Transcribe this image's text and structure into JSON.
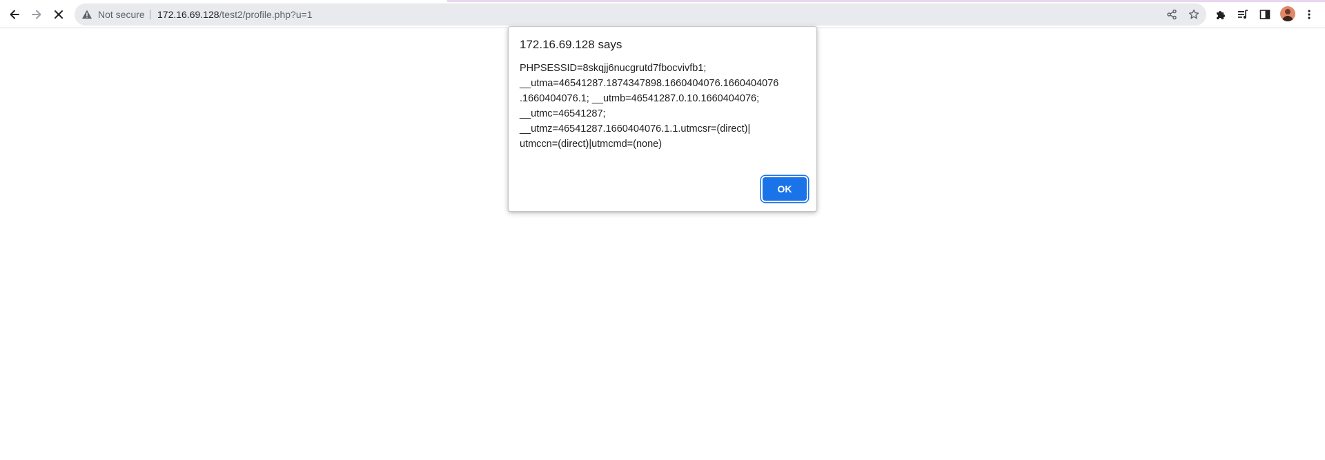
{
  "browser": {
    "omnibox": {
      "security_label": "Not secure",
      "url_host": "172.16.69.128",
      "url_path": "/test2/profile.php?u=1"
    },
    "icons": {
      "back": "back-arrow-icon",
      "forward": "forward-arrow-icon",
      "stop": "stop-loading-icon",
      "warning": "warning-icon",
      "share": "share-icon",
      "bookmark": "bookmark-star-icon",
      "extensions": "puzzle-icon",
      "media": "media-queue-icon",
      "side_panel": "side-panel-icon",
      "menu": "kebab-menu-icon"
    }
  },
  "dialog": {
    "title": "172.16.69.128 says",
    "message_lines": [
      "PHPSESSID=8skqjj6nucgrutd7fbocvivfb1;",
      "__utma=46541287.1874347898.1660404076.1660404076",
      ".1660404076.1; __utmb=46541287.0.10.1660404076;",
      "__utmc=46541287;",
      "__utmz=46541287.1660404076.1.1.utmcsr=(direct)|",
      "utmccn=(direct)|utmcmd=(none)"
    ],
    "ok_label": "OK"
  },
  "colors": {
    "accent": "#1a73e8",
    "omnibox_bg": "#e8eaed",
    "text": "#202124",
    "secondary_text": "#5f6368"
  }
}
